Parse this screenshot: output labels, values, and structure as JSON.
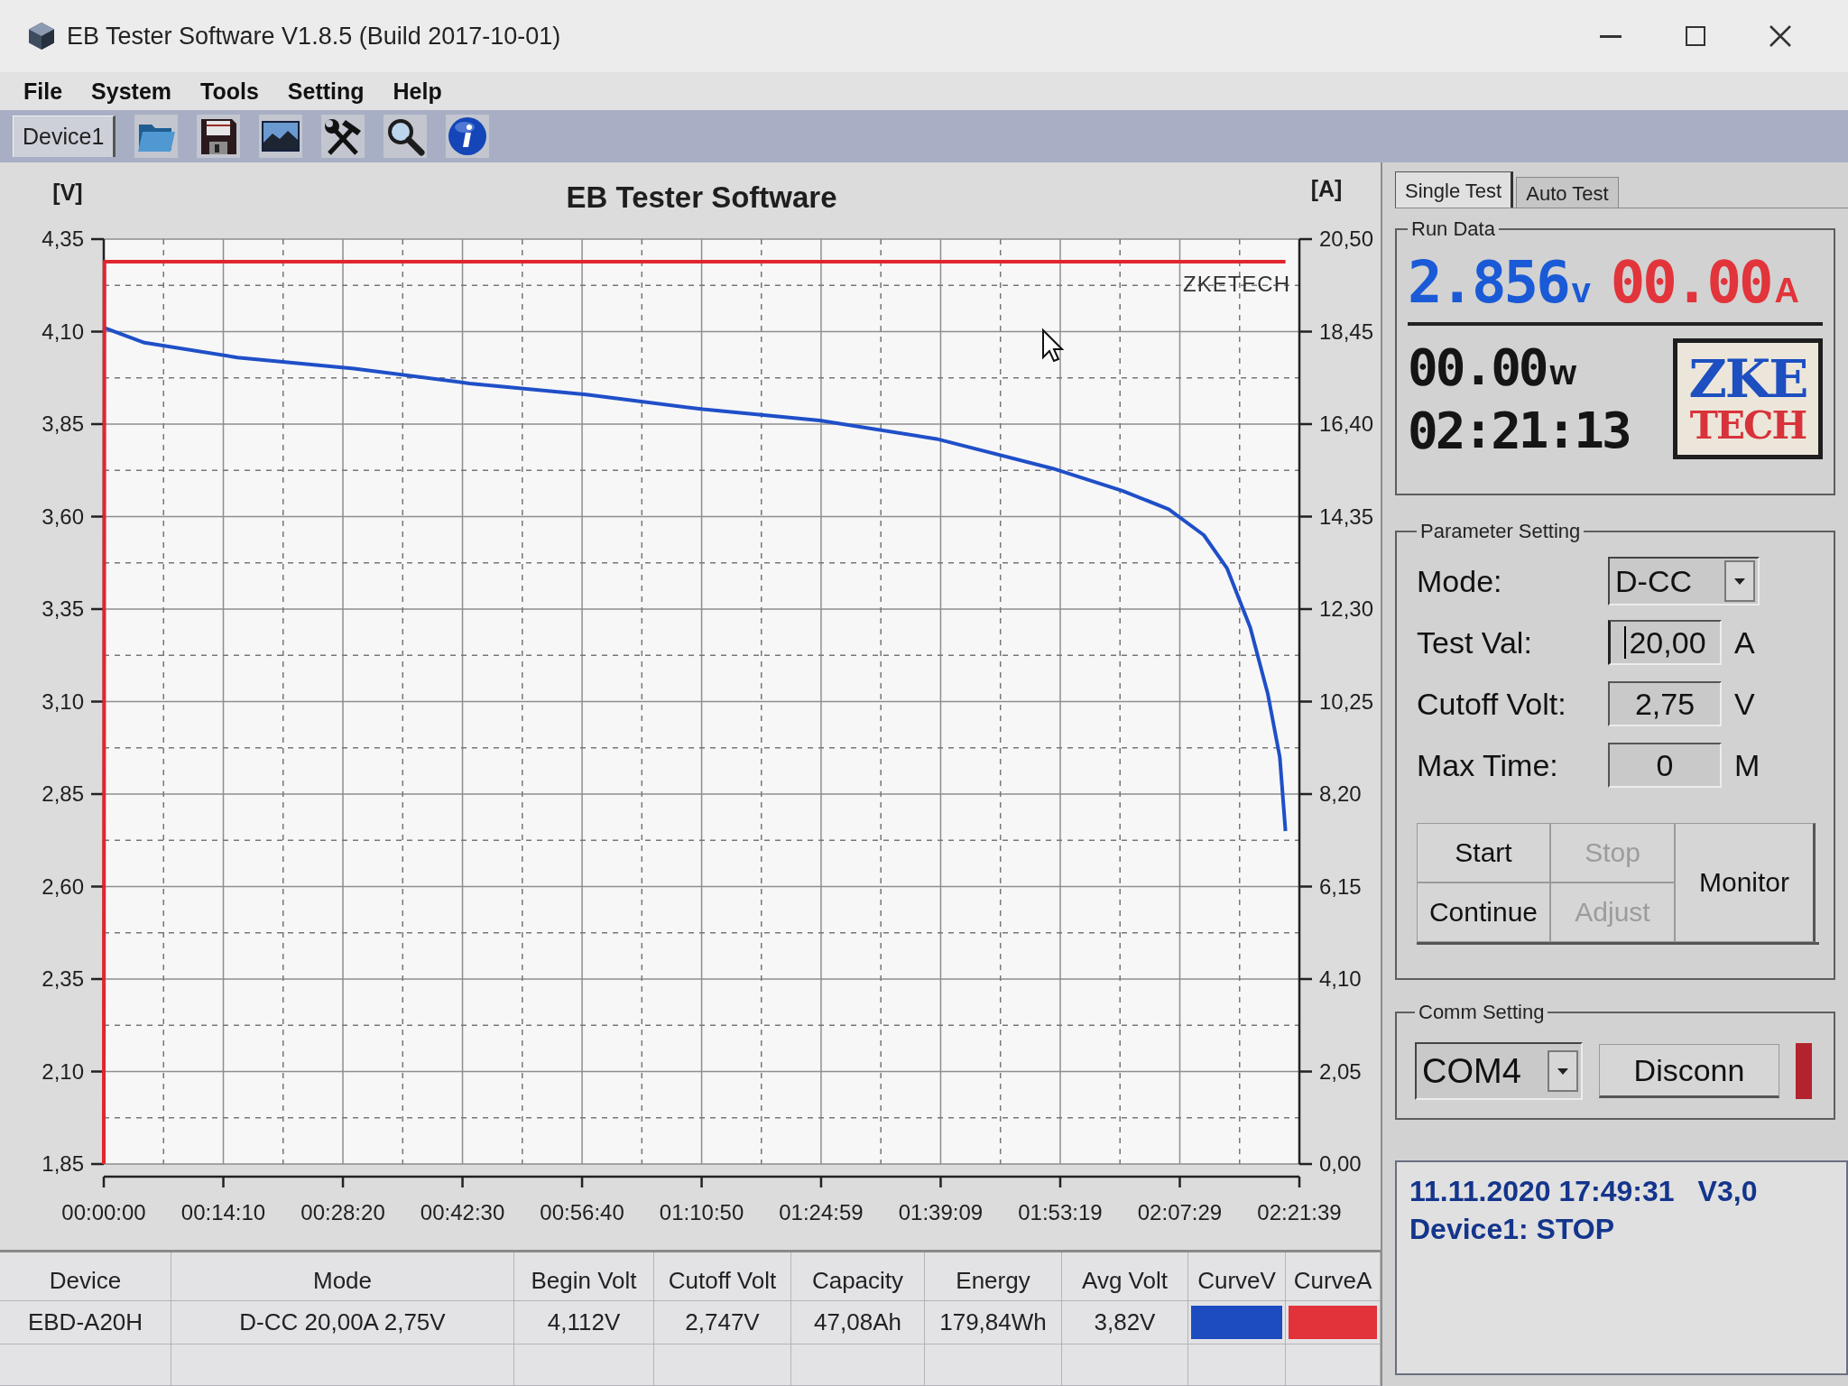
{
  "window": {
    "title": "EB Tester Software V1.8.5 (Build 2017-10-01)"
  },
  "menu": [
    "File",
    "System",
    "Tools",
    "Setting",
    "Help"
  ],
  "toolbar": {
    "device_tabs": [
      {
        "label": "Device1",
        "selected": true
      }
    ]
  },
  "chart": {
    "chart_data": {
      "type": "line",
      "title": "EB Tester Software",
      "ylabel": "[V]",
      "y2label": "[A]",
      "grid": true,
      "x": [
        0,
        5,
        290,
        950,
        1780,
        2600,
        3430,
        4260,
        5090,
        5920,
        6745,
        7240,
        7570,
        7820,
        7985,
        8150,
        8275,
        8360,
        8400
      ],
      "series": [
        {
          "color": "#1f4fc8",
          "values": [
            4.112,
            4.11,
            4.07,
            4.03,
            4.0,
            3.96,
            3.93,
            3.89,
            3.86,
            3.81,
            3.73,
            3.67,
            3.62,
            3.55,
            3.46,
            3.3,
            3.12,
            2.95,
            2.75
          ]
        },
        {
          "color": "#e0262f",
          "axis": "y2",
          "values": [
            0,
            20,
            20,
            20,
            20,
            20,
            20,
            20,
            20,
            20,
            20,
            20,
            20,
            20,
            20,
            20,
            20,
            20,
            20
          ]
        }
      ],
      "xlim": [
        0,
        8499
      ],
      "ylim": [
        1.85,
        4.35
      ],
      "y2lim": [
        0,
        20.5
      ],
      "xticks": [
        {
          "value": 0,
          "label": "00:00:00"
        },
        {
          "value": 850,
          "label": "00:14:10"
        },
        {
          "value": 1700,
          "label": "00:28:20"
        },
        {
          "value": 2550,
          "label": "00:42:30"
        },
        {
          "value": 3400,
          "label": "00:56:40"
        },
        {
          "value": 4250,
          "label": "01:10:50"
        },
        {
          "value": 5099,
          "label": "01:24:59"
        },
        {
          "value": 5949,
          "label": "01:39:09"
        },
        {
          "value": 6799,
          "label": "01:53:19"
        },
        {
          "value": 7649,
          "label": "02:07:29"
        },
        {
          "value": 8499,
          "label": "02:21:39"
        }
      ],
      "yticks": [
        {
          "value": 1.85,
          "label": "1,85"
        },
        {
          "value": 2.1,
          "label": "2,10"
        },
        {
          "value": 2.35,
          "label": "2,35"
        },
        {
          "value": 2.6,
          "label": "2,60"
        },
        {
          "value": 2.85,
          "label": "2,85"
        },
        {
          "value": 3.1,
          "label": "3,10"
        },
        {
          "value": 3.35,
          "label": "3,35"
        },
        {
          "value": 3.6,
          "label": "3,60"
        },
        {
          "value": 3.85,
          "label": "3,85"
        },
        {
          "value": 4.1,
          "label": "4,10"
        },
        {
          "value": 4.35,
          "label": "4,35"
        }
      ],
      "y2ticks": [
        {
          "value": 0,
          "label": "0,00"
        },
        {
          "value": 2.05,
          "label": "2,05"
        },
        {
          "value": 4.1,
          "label": "4,10"
        },
        {
          "value": 6.15,
          "label": "6,15"
        },
        {
          "value": 8.2,
          "label": "8,20"
        },
        {
          "value": 10.25,
          "label": "10,25"
        },
        {
          "value": 12.3,
          "label": "12,30"
        },
        {
          "value": 14.35,
          "label": "14,35"
        },
        {
          "value": 16.4,
          "label": "16,40"
        },
        {
          "value": 18.45,
          "label": "18,45"
        },
        {
          "value": 20.5,
          "label": "20,50"
        }
      ],
      "annotations": [
        {
          "text": "ZKETECH"
        }
      ]
    }
  },
  "right_panel": {
    "tabs": [
      {
        "label": "Single Test",
        "selected": true
      },
      {
        "label": "Auto Test",
        "selected": false
      }
    ],
    "run_data": {
      "title": "Run Data",
      "voltage": "2.856",
      "voltage_unit": "v",
      "current": "00.00",
      "current_unit": "A",
      "power": "00.00",
      "power_unit": "w",
      "time": "02:21:13",
      "logo": {
        "line_1": "ZKE",
        "line_2": "TECH"
      }
    },
    "parameter_setting": {
      "title": "Parameter Setting",
      "fields": [
        {
          "kind": "dropdown",
          "label": "Mode:",
          "value": "D-CC",
          "focused": false
        },
        {
          "kind": "input",
          "label": "Test Val:",
          "value": "20,00",
          "unit": "A",
          "focused": true
        },
        {
          "kind": "input",
          "label": "Cutoff Volt:",
          "value": "2,75",
          "unit": "V",
          "focused": false
        },
        {
          "kind": "input",
          "label": "Max Time:",
          "value": "0",
          "unit": "M",
          "focused": false
        }
      ],
      "buttons": [
        {
          "label": "Start",
          "disabled": false
        },
        {
          "label": "Stop",
          "disabled": true
        },
        {
          "label": "Monitor",
          "disabled": false
        },
        {
          "label": "Continue",
          "disabled": false
        },
        {
          "label": "Adjust",
          "disabled": true
        }
      ]
    },
    "comm_setting": {
      "title": "Comm Setting",
      "port": "COM4",
      "button": "Disconn",
      "connected": true
    },
    "status": {
      "datetime": "11.11.2020 17:49:31",
      "version": "V3,0",
      "message": "Device1: STOP"
    }
  },
  "table": {
    "columns": [
      "Device",
      "Mode",
      "Begin Volt",
      "Cutoff Volt",
      "Capacity",
      "Energy",
      "Avg Volt",
      "CurveV",
      "CurveA"
    ],
    "rows": [
      {
        "cells": [
          "EBD-A20H",
          "D-CC 20,00A 2,75V",
          "4,112V",
          "2,747V",
          "47,08Ah",
          "179,84Wh",
          "3,82V"
        ],
        "curves": [
          {
            "color": "#1c4cc0"
          },
          {
            "color": "#e2323a"
          }
        ]
      }
    ]
  }
}
